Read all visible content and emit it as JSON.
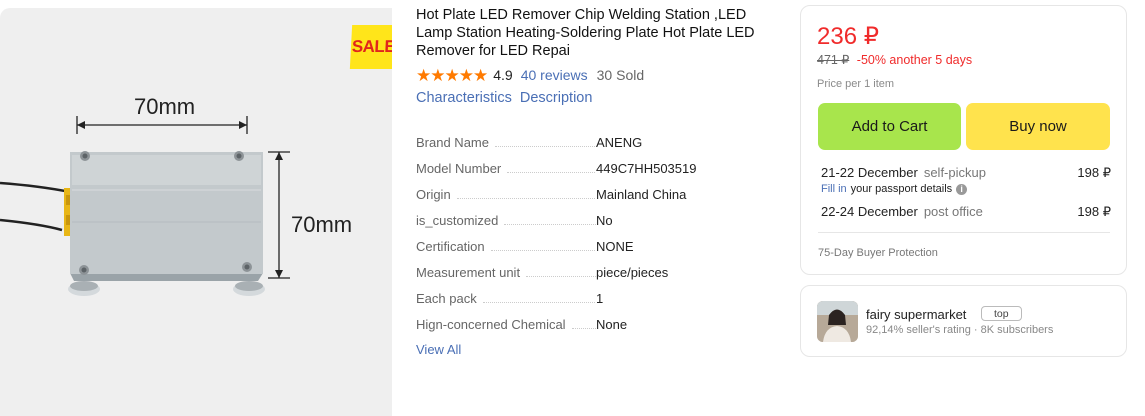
{
  "gallery": {
    "sale_badge": "SALE",
    "dim_top": "70mm",
    "dim_side": "70mm"
  },
  "product": {
    "title": "Hot Plate LED Remover Chip Welding Station ,LED Lamp Station Heating-Soldering Plate Hot Plate LED Remover for LED Repai",
    "rating": "4.9",
    "stars": 5,
    "reviews": "40 reviews",
    "sold": "30 Sold",
    "tabs": [
      "Characteristics",
      "Description"
    ]
  },
  "specs": [
    {
      "name": "Brand Name",
      "value": "ANENG"
    },
    {
      "name": "Model Number",
      "value": "449C7HH503519"
    },
    {
      "name": "Origin",
      "value": "Mainland China"
    },
    {
      "name": "is_customized",
      "value": "No"
    },
    {
      "name": "Certification",
      "value": "NONE"
    },
    {
      "name": "Measurement unit",
      "value": "piece/pieces"
    },
    {
      "name": "Each pack",
      "value": "1"
    },
    {
      "name": "Hign-concerned Chemical",
      "value": "None"
    }
  ],
  "view_all": "View All",
  "buybox": {
    "price": "236 ₽",
    "old_price": "471 ₽",
    "discount": "-50% another 5 days",
    "price_note": "Price per 1 item",
    "add_to_cart": "Add to Cart",
    "buy_now": "Buy now",
    "shipping": [
      {
        "date": "21-22 December",
        "method": "self-pickup",
        "price": "198 ₽"
      },
      {
        "date": "22-24 December",
        "method": "post office",
        "price": "198 ₽"
      }
    ],
    "passport_link": "Fill in",
    "passport_text": "your passport details",
    "protection": "75-Day Buyer Protection"
  },
  "seller": {
    "name": "fairy supermarket",
    "badge": "top",
    "meta": "92,14% seller's rating · 8K subscribers"
  },
  "colors": {
    "price_red": "#f02b2b",
    "link_blue": "#4a6fb5",
    "cart_green": "#a8e54c",
    "buy_yellow": "#ffe34d",
    "star_orange": "#ff7a00"
  }
}
